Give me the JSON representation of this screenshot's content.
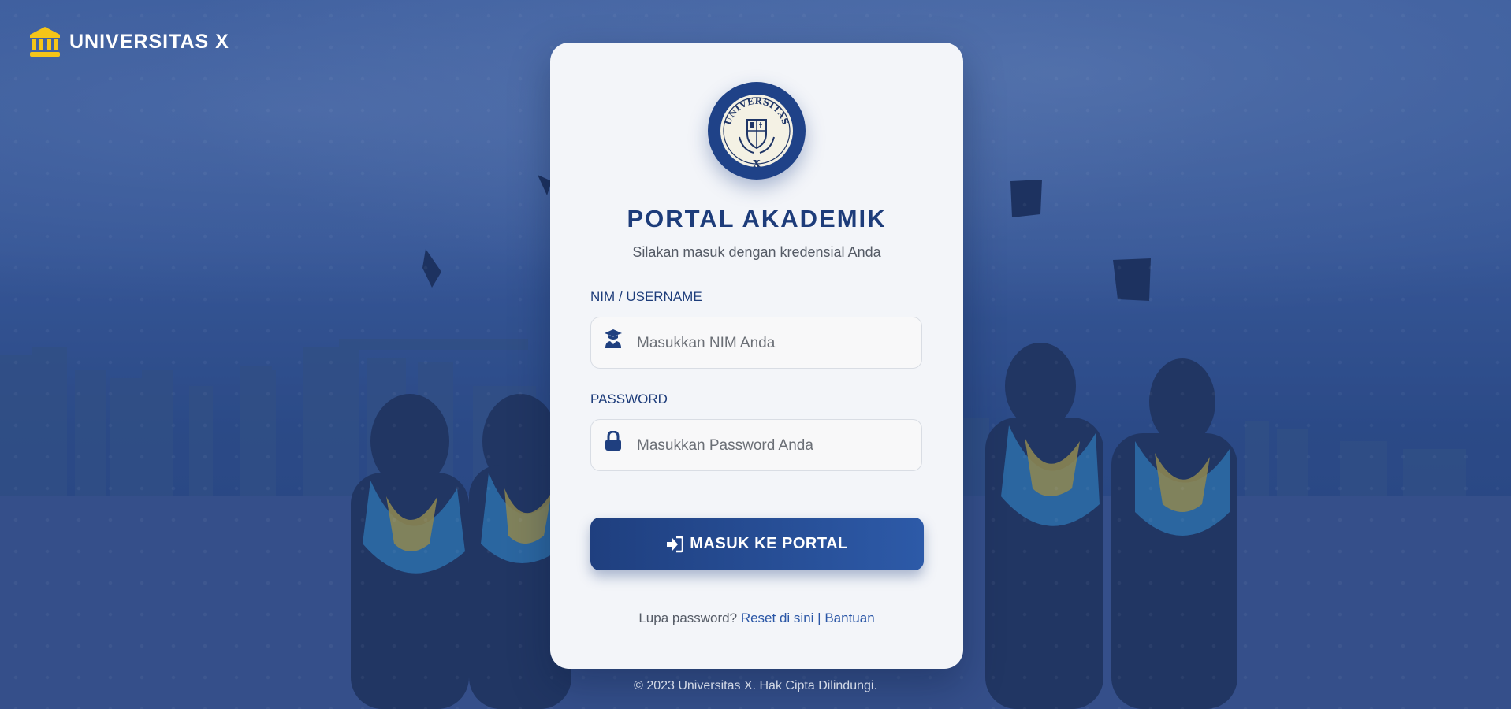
{
  "brand": {
    "name": "UNIVERSITAS X",
    "icon": "university-icon",
    "icon_color": "#f5c518"
  },
  "seal": {
    "top_text": "UNIVERSITAS",
    "bottom_text": "X"
  },
  "login": {
    "title": "PORTAL AKADEMIK",
    "subtitle": "Silakan masuk dengan kredensial Anda",
    "username_label": "NIM / USERNAME",
    "username_placeholder": "Masukkan NIM Anda",
    "username_icon": "graduate-user-icon",
    "password_label": "PASSWORD",
    "password_placeholder": "Masukkan Password Anda",
    "password_icon": "lock-icon",
    "submit_label": "MASUK KE PORTAL",
    "submit_icon": "sign-in-icon",
    "forgot_text": "Lupa password?",
    "reset_link": "Reset di sini",
    "separator": "|",
    "help_link": "Bantuan"
  },
  "footer": {
    "copyright": "© 2023 Universitas X. Hak Cipta Dilindungi."
  },
  "colors": {
    "primary": "#1d3c7a",
    "button_start": "#1f3f7f",
    "button_end": "#2d5aa8",
    "link": "#2a56a6",
    "card_bg": "#f3f5f9",
    "accent_gold": "#f5c518"
  }
}
